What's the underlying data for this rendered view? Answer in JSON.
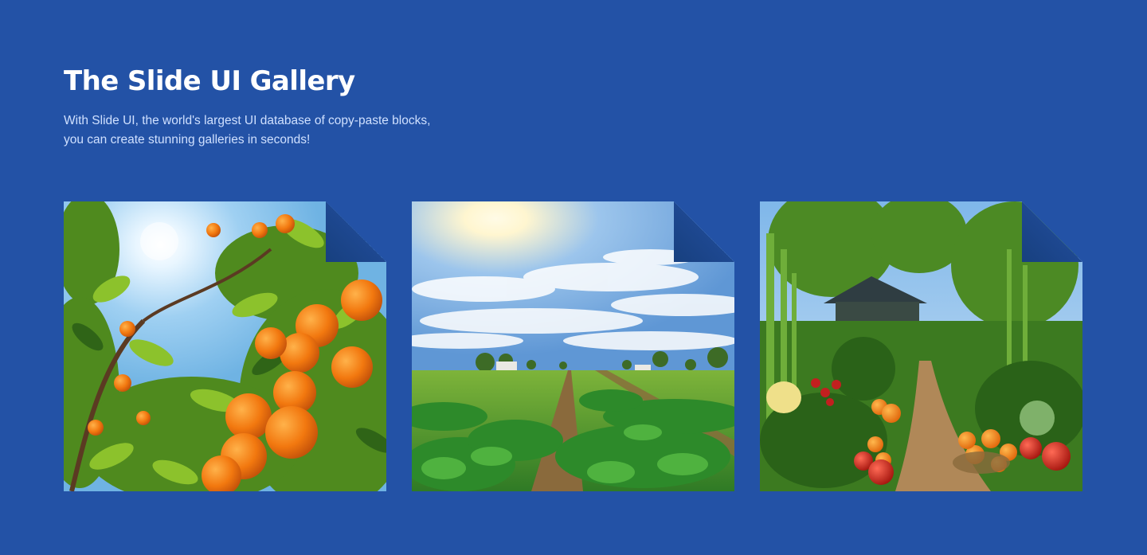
{
  "header": {
    "title": "The Slide UI Gallery",
    "description_line1": "With Slide UI, the world's largest UI database of copy-paste blocks,",
    "description_line2": "you can create stunning galleries in seconds!"
  },
  "gallery": {
    "items": [
      {
        "name": "orange-tree-image"
      },
      {
        "name": "crop-field-image"
      },
      {
        "name": "vegetable-garden-image"
      }
    ]
  },
  "colors": {
    "background": "#2352a6",
    "title": "#ffffff",
    "description": "#cfe0ff",
    "fold": "#1e4891"
  }
}
